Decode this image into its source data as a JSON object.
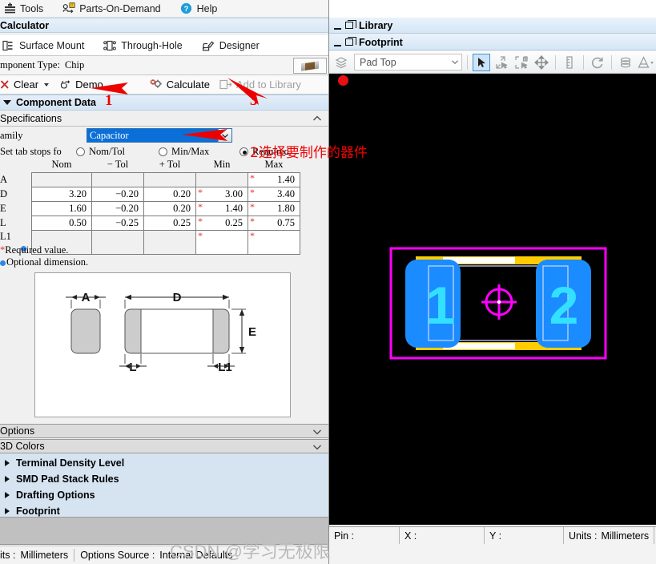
{
  "menubar": {
    "items": [
      {
        "label": "Tools",
        "icon": "tools-icon"
      },
      {
        "label": "Parts-On-Demand",
        "icon": "parts-on-demand-icon"
      },
      {
        "label": "Help",
        "icon": "help-icon"
      }
    ]
  },
  "calculator": {
    "header": "Calculator",
    "modes": [
      {
        "label": "Surface Mount",
        "icon": "surface-mount-icon"
      },
      {
        "label": "Through-Hole",
        "icon": "through-hole-icon"
      },
      {
        "label": "Designer",
        "icon": "designer-icon"
      }
    ],
    "component_type_label": "mponent Type:",
    "component_type_value": "Chip",
    "actions": {
      "clear": "Clear",
      "demo": "Demo",
      "calculate": "Calculate",
      "add_to_library": "Add to Library"
    },
    "component_data_header": "Component Data",
    "specifications_header": "Specifications"
  },
  "specifications": {
    "family_label": "amily",
    "family_value": "Capacitor",
    "tabstops_label": "Set tab stops fo",
    "tabstop_options": [
      {
        "label": "Nom/Tol",
        "selected": false
      },
      {
        "label": "Min/Max",
        "selected": false
      },
      {
        "label": "Required",
        "selected": true
      }
    ],
    "columns": [
      "Nom",
      "− Tol",
      "+ Tol",
      "Min",
      "Max"
    ],
    "rows": [
      {
        "name": "A",
        "nom": "",
        "ntol": "",
        "ptol": "",
        "min": "",
        "max": "1.40",
        "min_req": false,
        "max_req": true,
        "optional": false
      },
      {
        "name": "D",
        "nom": "3.20",
        "ntol": "−0.20",
        "ptol": "0.20",
        "min": "3.00",
        "max": "3.40",
        "min_req": true,
        "max_req": true,
        "optional": false
      },
      {
        "name": "E",
        "nom": "1.60",
        "ntol": "−0.20",
        "ptol": "0.20",
        "min": "1.40",
        "max": "1.80",
        "min_req": true,
        "max_req": true,
        "optional": false
      },
      {
        "name": "L",
        "nom": "0.50",
        "ntol": "−0.25",
        "ptol": "0.25",
        "min": "0.25",
        "max": "0.75",
        "min_req": true,
        "max_req": true,
        "optional": false
      },
      {
        "name": "L1",
        "nom": "",
        "ntol": "",
        "ptol": "",
        "min": "",
        "max": "",
        "min_req": true,
        "max_req": true,
        "optional": true
      }
    ],
    "legend_required": "Required value.",
    "legend_optional": "Optional dimension.",
    "legend_required_mark": "*",
    "drawing": {
      "dim_a": "A",
      "dim_d": "D",
      "dim_e": "E",
      "dim_l": "L",
      "dim_l1": "L1"
    }
  },
  "options_panel": {
    "options_header": "Options",
    "colors_header": "3D Colors",
    "tree": [
      "Terminal Density Level",
      "SMD Pad Stack Rules",
      "Drafting Options",
      "Footprint"
    ]
  },
  "left_status": {
    "units_label": "its :",
    "units_value": "Millimeters",
    "options_source_label": "Options Source :",
    "options_source_value": "Internal Defaults"
  },
  "library_dock": {
    "title": "Library"
  },
  "footprint_dock": {
    "title": "Footprint",
    "layer_value": "Pad Top",
    "tools": [
      {
        "name": "layers-stack-icon",
        "active": false
      },
      {
        "name": "select-arrow-icon",
        "active": true
      },
      {
        "name": "zoom-to-selection-icon",
        "active": false
      },
      {
        "name": "zoom-area-icon",
        "active": false
      },
      {
        "name": "pan-move-icon",
        "active": false
      },
      {
        "name": "measure-icon",
        "active": false
      },
      {
        "name": "refresh-icon",
        "active": false
      },
      {
        "name": "layer-colors-icon",
        "active": false
      },
      {
        "name": "draw-tool-icon",
        "active": false
      }
    ]
  },
  "canvas": {
    "pad1_label": "1",
    "pad2_label": "2",
    "colors": {
      "outline": "#ff00ff",
      "pad": "#1a8cff",
      "pad_label": "#33e0ff",
      "body_yellow": "#ffcc00",
      "body_white": "#ffffff",
      "background": "#000000",
      "origin_marker": "#ff00ff"
    }
  },
  "right_status": {
    "pin_label": "Pin :",
    "pin_value": "",
    "x_label": "X :",
    "x_value": "",
    "y_label": "Y :",
    "y_value": "",
    "units_label": "Units :",
    "units_value": "Millimeters"
  },
  "watermark": "CSDN @学习无极限",
  "annotations": [
    {
      "id": "a1",
      "text": "1"
    },
    {
      "id": "a2",
      "text": "2选择要制作的器件"
    },
    {
      "id": "a3",
      "text": "3"
    }
  ]
}
